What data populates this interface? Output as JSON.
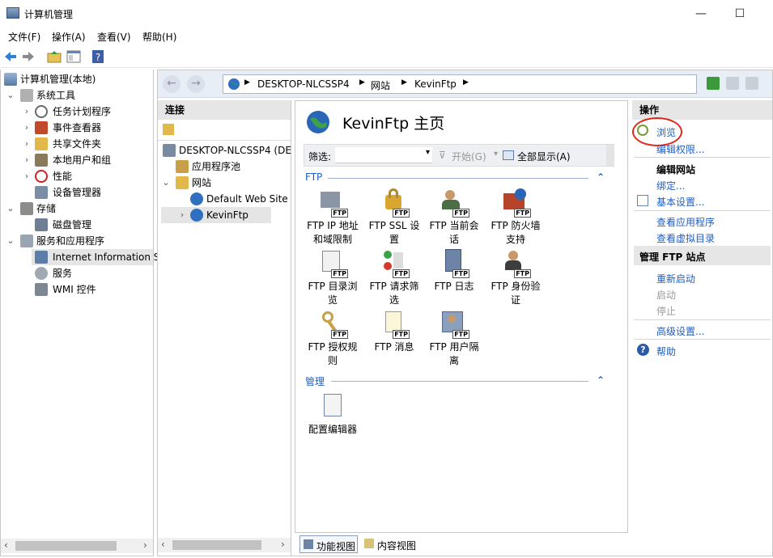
{
  "window": {
    "title": "计算机管理",
    "minimize": "—",
    "maximize": "☐"
  },
  "menu": [
    "文件(F)",
    "操作(A)",
    "查看(V)",
    "帮助(H)"
  ],
  "tree": {
    "root": "计算机管理(本地)",
    "system_tools": "系统工具",
    "task_scheduler": "任务计划程序",
    "event_viewer": "事件查看器",
    "shared_folders": "共享文件夹",
    "local_users": "本地用户和组",
    "performance": "性能",
    "device_manager": "设备管理器",
    "storage": "存储",
    "disk_mgmt": "磁盘管理",
    "services_apps": "服务和应用程序",
    "iis": "Internet Information S",
    "services": "服务",
    "wmi": "WMI 控件"
  },
  "address": {
    "parts": [
      "DESKTOP-NLCSSP4",
      "网站",
      "KevinFtp"
    ]
  },
  "connections": {
    "header": "连接",
    "server": "DESKTOP-NLCSSP4 (DE",
    "app_pools": "应用程序池",
    "sites": "网站",
    "default_site": "Default Web Site",
    "kevinftp": "KevinFtp"
  },
  "center": {
    "title": "KevinFtp 主页",
    "filter_label": "筛选:",
    "start_label": "开始(G)",
    "show_all_label": "全部显示(A)",
    "group_ftp": "FTP",
    "group_mgmt": "管理",
    "features": [
      {
        "line1": "FTP IP 地址",
        "line2": "和域限制"
      },
      {
        "line1": "FTP SSL 设",
        "line2": "置"
      },
      {
        "line1": "FTP 当前会",
        "line2": "话"
      },
      {
        "line1": "FTP 防火墙",
        "line2": "支持"
      },
      {
        "line1": "FTP 目录浏",
        "line2": "览"
      },
      {
        "line1": "FTP 请求筛",
        "line2": "选"
      },
      {
        "line1": "FTP 日志",
        "line2": ""
      },
      {
        "line1": "FTP 身份验",
        "line2": "证"
      },
      {
        "line1": "FTP 授权规",
        "line2": "则"
      },
      {
        "line1": "FTP 消息",
        "line2": ""
      },
      {
        "line1": "FTP 用户隔",
        "line2": "离"
      }
    ],
    "config_editor": "配置编辑器",
    "icon_badge": "FTP",
    "features_view": "功能视图",
    "content_view": "内容视图"
  },
  "actions": {
    "header": "操作",
    "browse": "浏览",
    "edit_perms": "编辑权限...",
    "edit_site": "编辑网站",
    "bindings": "绑定...",
    "basic_settings": "基本设置...",
    "view_apps": "查看应用程序",
    "view_vdirs": "查看虚拟目录",
    "manage_ftp": "管理 FTP 站点",
    "restart": "重新启动",
    "start": "启动",
    "stop": "停止",
    "advanced": "高级设置...",
    "help": "帮助"
  },
  "colors": {
    "accent": "#1e5ebf",
    "highlight_circle": "#e0271d"
  }
}
